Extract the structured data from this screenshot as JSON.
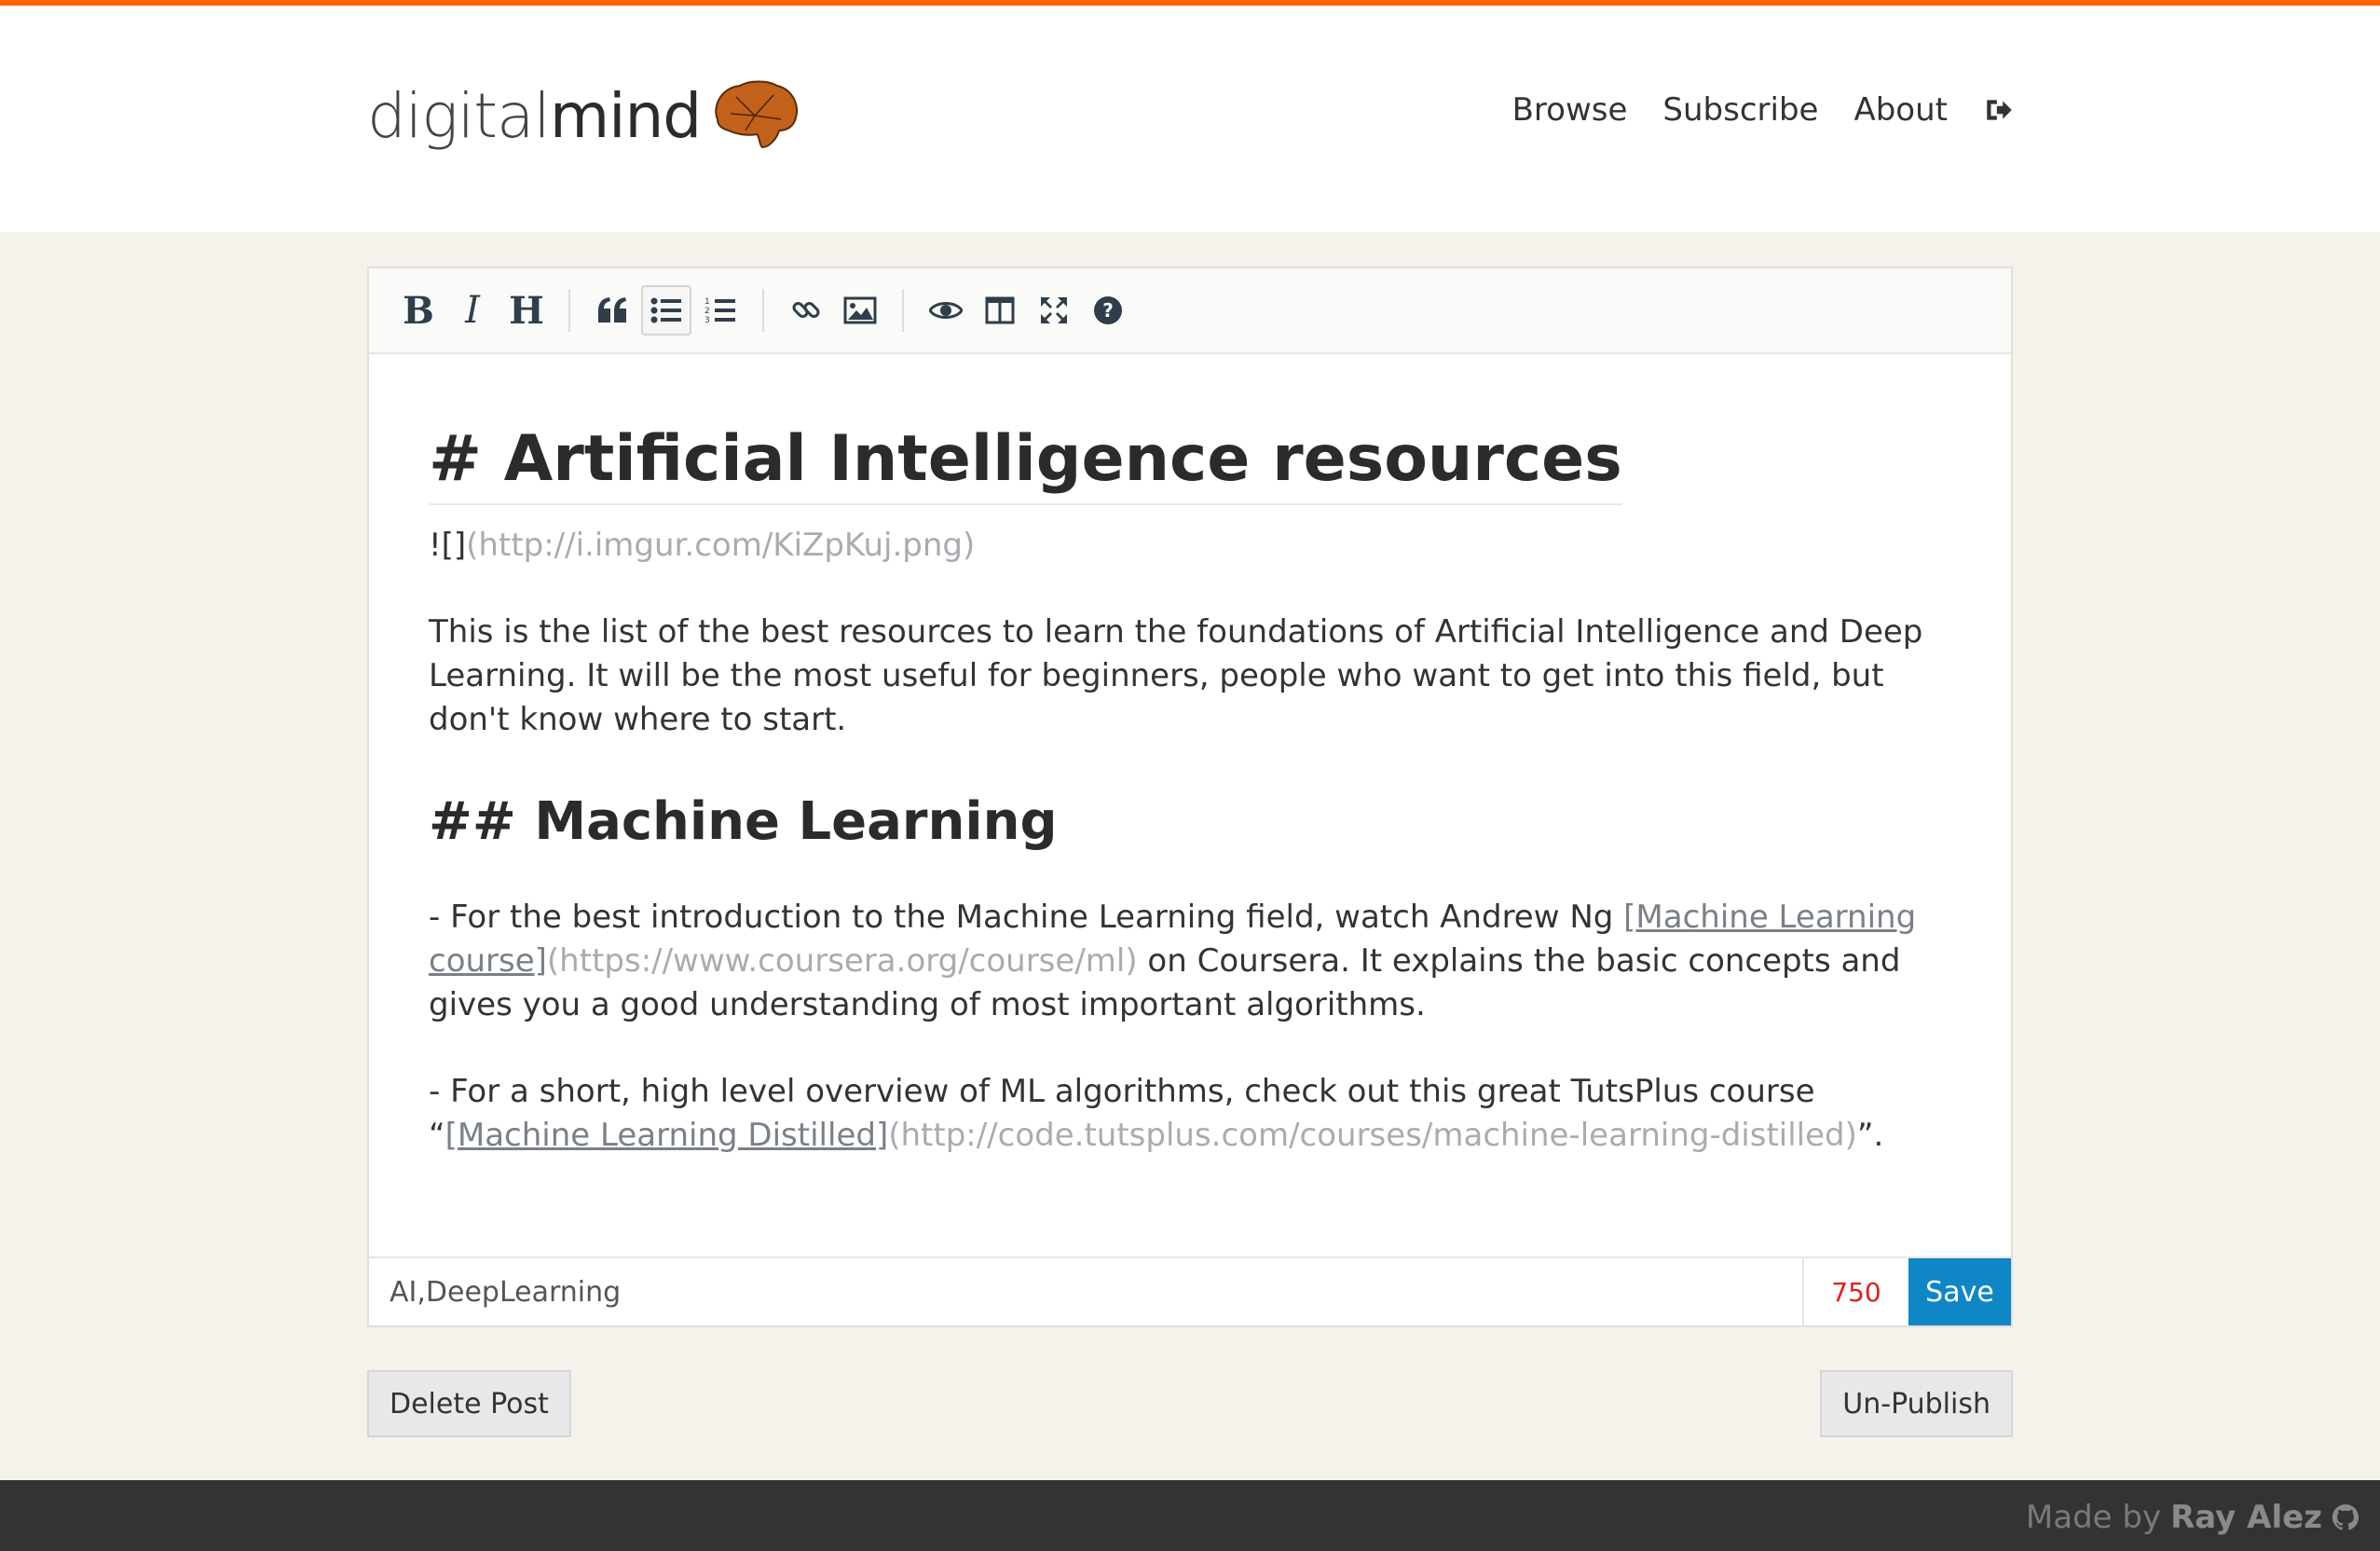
{
  "brand": {
    "name_part1": "digital",
    "name_part2": "mind",
    "logo_icon": "brain-icon",
    "accent": "#ff6600"
  },
  "nav": {
    "items": [
      "Browse",
      "Subscribe",
      "About"
    ],
    "signout_icon": "sign-out-icon"
  },
  "toolbar": {
    "buttons": [
      "bold",
      "italic",
      "heading",
      "quote",
      "unordered-list",
      "ordered-list",
      "link",
      "image",
      "preview",
      "side-by-side",
      "fullscreen",
      "guide"
    ],
    "bold_label": "B",
    "italic_label": "I",
    "heading_label": "H"
  },
  "document": {
    "h1": "# Artificial Intelligence resources",
    "image_prefix": "!",
    "image_brackets": "[]",
    "image_url": "(http://i.imgur.com/KiZpKuj.png)",
    "intro": "This is the list of the best resources to learn the foundations of Artificial Intelligence and Deep Learning. It will be the most useful for beginners, people who want to get into this field, but don't know where to start.",
    "h2": "## Machine Learning",
    "item1_pre": "- For the best introduction to the Machine Learning field, watch Andrew Ng ",
    "item1_link": "[Machine Learning course]",
    "item1_url": "(https://www.coursera.org/course/ml)",
    "item1_post": " on Coursera. It explains the basic concepts and gives you a good understanding of most important algorithms.",
    "item2_pre": "- For a short, high level overview of ML algorithms, check out this great TutsPlus course “",
    "item2_link": "[Machine Learning Distilled]",
    "item2_url": "(http://code.tutsplus.com/courses/machine-learning-distilled)",
    "item2_post": "”."
  },
  "tags": {
    "value": "AI,DeepLearning"
  },
  "counter": {
    "value": "750",
    "color": "#e0201a"
  },
  "actions": {
    "save": "Save",
    "delete": "Delete Post",
    "unpublish": "Un-Publish",
    "save_color": "#0f86c6"
  },
  "footer": {
    "made_by": "Made by",
    "author": "Ray Alez",
    "icon": "github-icon"
  }
}
